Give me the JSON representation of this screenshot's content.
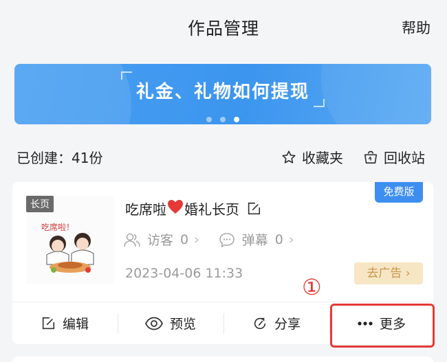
{
  "header": {
    "title": "作品管理",
    "help": "帮助"
  },
  "banner": {
    "text": "礼金、礼物如何提现",
    "dots": 3,
    "active_dot": 2
  },
  "toolbar": {
    "created": "已创建：41份",
    "favorites": "收藏夹",
    "recycle": "回收站"
  },
  "card": {
    "thumb_tag": "长页",
    "thumb_caption": "吃席啦！",
    "badge": "免费版",
    "title_prefix": "吃席啦",
    "title_suffix": "婚礼长页",
    "visitors_label": "访客",
    "visitors_count": "0",
    "barrage_label": "弹幕",
    "barrage_count": "0",
    "date": "2023-04-06 11:33",
    "ad_label": "去广告 ›"
  },
  "actions": {
    "edit": "编辑",
    "preview": "预览",
    "share": "分享",
    "more": "更多"
  },
  "annotation": {
    "marker": "①"
  },
  "colors": {
    "accent": "#3d8ef0",
    "highlight": "#e53935",
    "ad_bg": "#f6e6c4",
    "ad_text": "#c8964a"
  }
}
